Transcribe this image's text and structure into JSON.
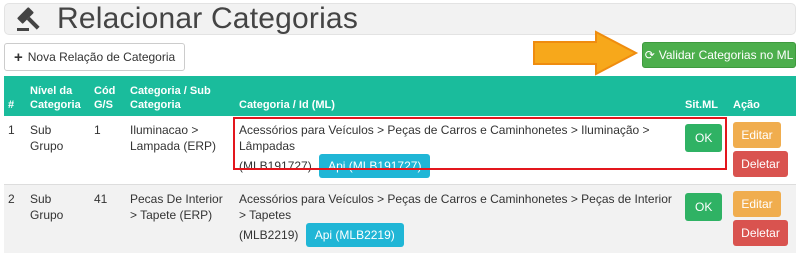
{
  "header": {
    "title": "Relacionar Categorias",
    "icon": "gavel-icon"
  },
  "toolbar": {
    "new_label": "Nova Relação de Categoria",
    "validate_label": "Validar Categorias no ML"
  },
  "table": {
    "columns": [
      "#",
      "Nível da Categoria",
      "Cód G/S",
      "Categoria / Sub Categoria",
      "Categoria / Id (ML)",
      "Sit.ML",
      "Ação"
    ],
    "rows": [
      {
        "num": "1",
        "nivel": "Sub Grupo",
        "cod": "1",
        "categoria": "Iluminacao > Lampada (ERP)",
        "ml_path": "Acessórios para Veículos > Peças de Carros e Caminhonetes > Iluminação > Lâmpadas",
        "ml_id": "(MLB191727)",
        "api_label": "Api (MLB191727)",
        "sit": "OK",
        "edit_label": "Editar",
        "delete_label": "Deletar"
      },
      {
        "num": "2",
        "nivel": "Sub Grupo",
        "cod": "41",
        "categoria": "Pecas De Interior > Tapete (ERP)",
        "ml_path": "Acessórios para Veículos > Peças de Carros e Caminhonetes > Peças de Interior > Tapetes",
        "ml_id": "(MLB2219)",
        "api_label": "Api (MLB2219)",
        "sit": "OK",
        "edit_label": "Editar",
        "delete_label": "Deletar"
      }
    ]
  },
  "colors": {
    "header_bg": "#1abc9c",
    "validate_btn": "#4cae4c",
    "api_btn": "#20b6d6",
    "ok_btn": "#2fb264",
    "edit_btn": "#f0ad4e",
    "delete_btn": "#d9534f",
    "arrow": "#f7a81b",
    "highlight": "#e3161d"
  }
}
